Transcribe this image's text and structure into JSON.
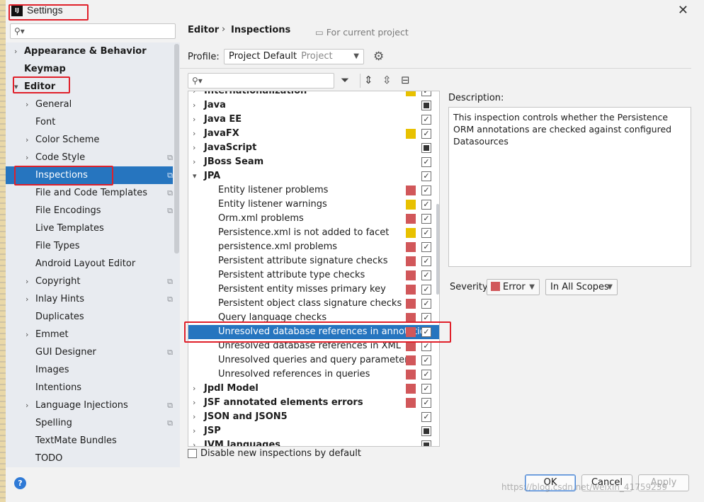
{
  "window": {
    "title": "Settings"
  },
  "left_panel": {
    "items": [
      {
        "label": "Appearance & Behavior",
        "bold": true,
        "arrow": "right",
        "level": 0
      },
      {
        "label": "Keymap",
        "bold": true,
        "arrow": "",
        "level": 0
      },
      {
        "label": "Editor",
        "bold": true,
        "arrow": "down",
        "level": 0
      },
      {
        "label": "General",
        "bold": false,
        "arrow": "right",
        "level": 1
      },
      {
        "label": "Font",
        "bold": false,
        "arrow": "",
        "level": 1
      },
      {
        "label": "Color Scheme",
        "bold": false,
        "arrow": "right",
        "level": 1
      },
      {
        "label": "Code Style",
        "bold": false,
        "arrow": "right",
        "level": 1,
        "copy": true
      },
      {
        "label": "Inspections",
        "bold": false,
        "arrow": "",
        "level": 1,
        "copy": true,
        "selected": true
      },
      {
        "label": "File and Code Templates",
        "bold": false,
        "arrow": "",
        "level": 1,
        "copy": true
      },
      {
        "label": "File Encodings",
        "bold": false,
        "arrow": "",
        "level": 1,
        "copy": true
      },
      {
        "label": "Live Templates",
        "bold": false,
        "arrow": "",
        "level": 1
      },
      {
        "label": "File Types",
        "bold": false,
        "arrow": "",
        "level": 1
      },
      {
        "label": "Android Layout Editor",
        "bold": false,
        "arrow": "",
        "level": 1
      },
      {
        "label": "Copyright",
        "bold": false,
        "arrow": "right",
        "level": 1,
        "copy": true
      },
      {
        "label": "Inlay Hints",
        "bold": false,
        "arrow": "right",
        "level": 1,
        "copy": true
      },
      {
        "label": "Duplicates",
        "bold": false,
        "arrow": "",
        "level": 1
      },
      {
        "label": "Emmet",
        "bold": false,
        "arrow": "right",
        "level": 1
      },
      {
        "label": "GUI Designer",
        "bold": false,
        "arrow": "",
        "level": 1,
        "copy": true
      },
      {
        "label": "Images",
        "bold": false,
        "arrow": "",
        "level": 1
      },
      {
        "label": "Intentions",
        "bold": false,
        "arrow": "",
        "level": 1
      },
      {
        "label": "Language Injections",
        "bold": false,
        "arrow": "right",
        "level": 1,
        "copy": true
      },
      {
        "label": "Spelling",
        "bold": false,
        "arrow": "",
        "level": 1,
        "copy": true
      },
      {
        "label": "TextMate Bundles",
        "bold": false,
        "arrow": "",
        "level": 1
      },
      {
        "label": "TODO",
        "bold": false,
        "arrow": "",
        "level": 1
      }
    ]
  },
  "breadcrumb": {
    "parent": "Editor",
    "current": "Inspections",
    "scope_note": "For current project"
  },
  "profile": {
    "label": "Profile:",
    "name": "Project Default",
    "type": "Project"
  },
  "inspections": [
    {
      "label": "Internationalization",
      "group": true,
      "arrow": "right",
      "severity": "warning",
      "check": "checked",
      "clipped": true
    },
    {
      "label": "Java",
      "group": true,
      "arrow": "right",
      "severity": "",
      "check": "mixed"
    },
    {
      "label": "Java EE",
      "group": true,
      "arrow": "right",
      "severity": "",
      "check": "checked"
    },
    {
      "label": "JavaFX",
      "group": true,
      "arrow": "right",
      "severity": "warning",
      "check": "checked"
    },
    {
      "label": "JavaScript",
      "group": true,
      "arrow": "right",
      "severity": "",
      "check": "mixed"
    },
    {
      "label": "JBoss Seam",
      "group": true,
      "arrow": "right",
      "severity": "",
      "check": "checked"
    },
    {
      "label": "JPA",
      "group": true,
      "arrow": "down",
      "severity": "",
      "check": "checked"
    },
    {
      "label": "Entity listener problems",
      "group": false,
      "severity": "error",
      "check": "checked"
    },
    {
      "label": "Entity listener warnings",
      "group": false,
      "severity": "warning",
      "check": "checked"
    },
    {
      "label": "Orm.xml problems",
      "group": false,
      "severity": "error",
      "check": "checked"
    },
    {
      "label": "Persistence.xml is not added to facet",
      "group": false,
      "severity": "warning",
      "check": "checked"
    },
    {
      "label": "persistence.xml problems",
      "group": false,
      "severity": "error",
      "check": "checked"
    },
    {
      "label": "Persistent attribute signature checks",
      "group": false,
      "severity": "error",
      "check": "checked"
    },
    {
      "label": "Persistent attribute type checks",
      "group": false,
      "severity": "error",
      "check": "checked"
    },
    {
      "label": "Persistent entity misses primary key",
      "group": false,
      "severity": "error",
      "check": "checked"
    },
    {
      "label": "Persistent object class signature checks",
      "group": false,
      "severity": "error",
      "check": "checked"
    },
    {
      "label": "Query language checks",
      "group": false,
      "severity": "error",
      "check": "checked"
    },
    {
      "label": "Unresolved database references in annotatic",
      "group": false,
      "severity": "error",
      "check": "checked",
      "selected": true
    },
    {
      "label": "Unresolved database references in XML",
      "group": false,
      "severity": "error",
      "check": "checked"
    },
    {
      "label": "Unresolved queries and query parameters",
      "group": false,
      "severity": "error",
      "check": "checked"
    },
    {
      "label": "Unresolved references in queries",
      "group": false,
      "severity": "error",
      "check": "checked"
    },
    {
      "label": "Jpdl Model",
      "group": true,
      "arrow": "right",
      "severity": "error",
      "check": "checked"
    },
    {
      "label": "JSF annotated elements errors",
      "group": true,
      "arrow": "right",
      "severity": "error",
      "check": "checked"
    },
    {
      "label": "JSON and JSON5",
      "group": true,
      "arrow": "right",
      "severity": "",
      "check": "checked"
    },
    {
      "label": "JSP",
      "group": true,
      "arrow": "right",
      "severity": "",
      "check": "mixed"
    },
    {
      "label": "JVM languages",
      "group": true,
      "arrow": "right",
      "severity": "",
      "check": "mixed",
      "clipped": true
    }
  ],
  "disable_new": {
    "label": "Disable new inspections by default",
    "checked": false
  },
  "description": {
    "label": "Description:",
    "text": "This inspection controls whether the Persistence ORM annotations are checked against configured Datasources"
  },
  "severity": {
    "label": "Severity:",
    "value": "Error",
    "color": "#d1575a",
    "scope": "In All Scopes"
  },
  "buttons": {
    "ok": "OK",
    "cancel": "Cancel",
    "apply": "Apply",
    "help": "?"
  },
  "watermark": "https://blog.csdn.net/weixin_41759239",
  "colors": {
    "error": "#d1575a",
    "warning": "#e8c100",
    "selection": "#2675bf",
    "annotation_red": "#e0202a"
  },
  "icons": {
    "search": "search-icon",
    "filter": "filter-icon",
    "expand_all": "expand-all-icon",
    "collapse_all": "collapse-all-icon",
    "reset": "reset-icon",
    "gear": "gear-icon",
    "close": "close-icon"
  }
}
